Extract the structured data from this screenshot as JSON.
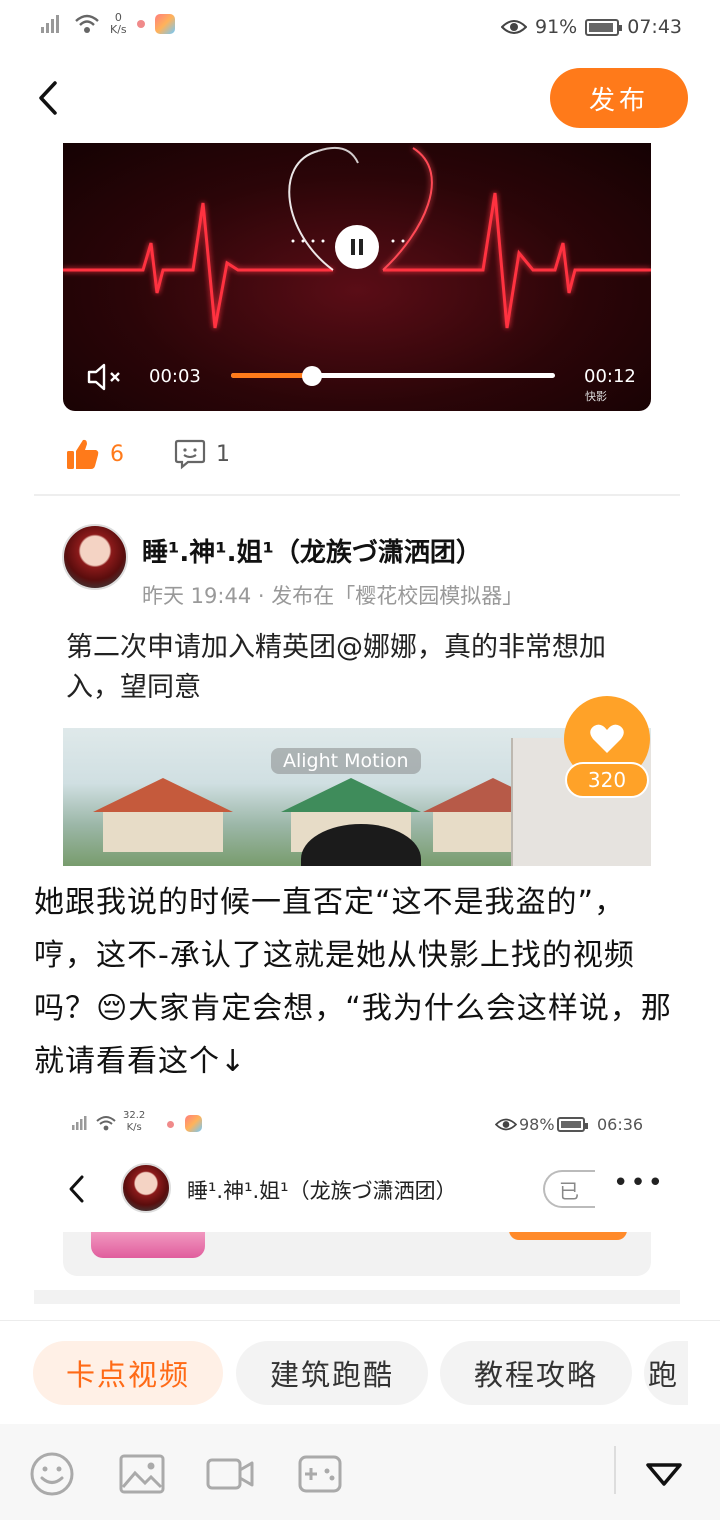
{
  "status_bar": {
    "net_speed_value": "0",
    "net_speed_unit": "K/s",
    "battery_percent": "91%",
    "time": "07:43"
  },
  "header": {
    "publish_label": "发布"
  },
  "video": {
    "current_time": "00:03",
    "total_time": "00:12",
    "progress": 0.25,
    "watermark": "快影"
  },
  "reactions": {
    "likes": "6",
    "comments": "1"
  },
  "post": {
    "username": "睡¹.神¹.姐¹（龙族づ潇洒团）",
    "meta": "昨天 19:44 · 发布在「樱花校园模拟器」",
    "text": "第二次申请加入精英团@娜娜，真的非常想加入，望同意",
    "thumbnail_badge": "Alight Motion",
    "heart_count": "320"
  },
  "caption": {
    "text": "她跟我说的时候一直否定“这不是我盗的”，哼，这不-承认了这就是她从快影上找的视频吗？😔大家肯定会想，“我为什么会这样说，那就请看看这个↓"
  },
  "embedded_screenshot": {
    "net_speed_value": "32.2",
    "net_speed_unit": "K/s",
    "battery_percent": "98%",
    "time": "06:36",
    "username": "睡¹.神¹.姐¹（龙族づ潇洒团）",
    "follow_label": "已",
    "more_label": "•••"
  },
  "topic_chips": [
    {
      "label": "卡点视频",
      "active": true
    },
    {
      "label": "建筑跑酷",
      "active": false
    },
    {
      "label": "教程攻略",
      "active": false
    },
    {
      "label": "跑",
      "active": false
    }
  ],
  "toolbar": {
    "icons": [
      "emoji-icon",
      "image-icon",
      "video-camera-icon",
      "gamepad-icon",
      "collapse-icon"
    ]
  },
  "colors": {
    "accent": "#ff7a1a",
    "heart_fab": "#ffa228",
    "chip_active_bg": "#fff0e6",
    "chip_active_text": "#ff6a16"
  }
}
